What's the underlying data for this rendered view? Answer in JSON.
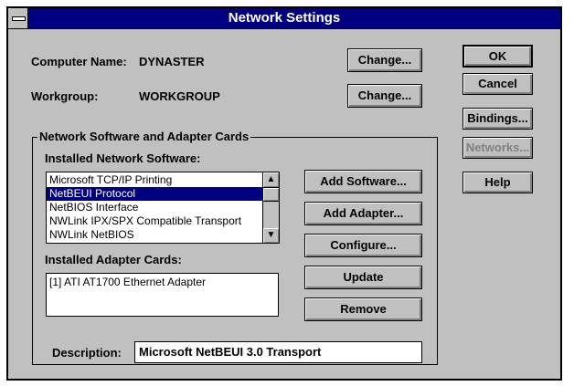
{
  "window": {
    "title": "Network Settings"
  },
  "computer": {
    "label": "Computer Name:",
    "value": "DYNASTER",
    "change_button": "Change..."
  },
  "workgroup": {
    "label": "Workgroup:",
    "value": "WORKGROUP",
    "change_button": "Change..."
  },
  "side_buttons": {
    "ok": "OK",
    "cancel": "Cancel",
    "bindings": "Bindings...",
    "networks": "Networks...",
    "help": "Help"
  },
  "group": {
    "legend": "Network Software and Adapter Cards",
    "installed_software_label": "Installed Network Software:",
    "software_items": [
      "Microsoft TCP/IP Printing",
      "NetBEUI Protocol",
      "NetBIOS Interface",
      "NWLink IPX/SPX Compatible Transport",
      "NWLink NetBIOS"
    ],
    "selected_software_index": 1,
    "installed_adapters_label": "Installed Adapter Cards:",
    "adapter_items": [
      "[1] ATI AT1700 Ethernet Adapter"
    ],
    "buttons": {
      "add_software": "Add Software...",
      "add_adapter": "Add Adapter...",
      "configure": "Configure...",
      "update": "Update",
      "remove": "Remove"
    },
    "description_label": "Description:",
    "description_value": "Microsoft NetBEUI 3.0 Transport"
  },
  "icons": {
    "scroll_up": "up-arrow-icon",
    "scroll_down": "down-arrow-icon",
    "system_menu": "system-menu-icon"
  },
  "colors": {
    "titlebar": "#000080",
    "dialog": "#c0c0c0",
    "selection": "#000080"
  }
}
